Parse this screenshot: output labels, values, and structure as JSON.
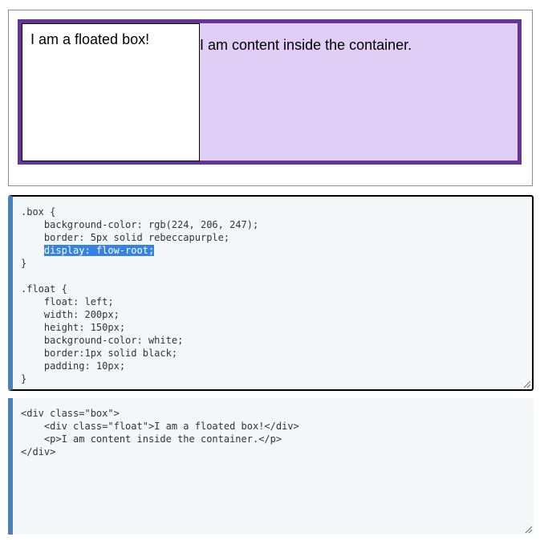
{
  "preview": {
    "float_text": "I am a floated box!",
    "content_text": "I am content inside the container."
  },
  "css_editor": {
    "lines": [
      ".box {",
      "    background-color: rgb(224, 206, 247);",
      "    border: 5px solid rebeccapurple;",
      "",
      "}",
      "",
      ".float {",
      "    float: left;",
      "    width: 200px;",
      "    height: 150px;",
      "    background-color: white;",
      "    border:1px solid black;",
      "    padding: 10px;",
      "}"
    ],
    "selected_text": "display: flow-root;",
    "selected_indent": "    "
  },
  "html_editor": {
    "lines": [
      "<div class=\"box\">",
      "    <div class=\"float\">I am a floated box!</div>",
      "    <p>I am content inside the container.</p>",
      "</div>"
    ]
  },
  "colors": {
    "box_background": "#e0cef7",
    "box_border": "#663399",
    "editor_background": "#f4f7f8",
    "editor_accent": "#4d82b8",
    "selection": "#3584e4"
  },
  "icons": {
    "resize": "resize-grip-icon"
  }
}
